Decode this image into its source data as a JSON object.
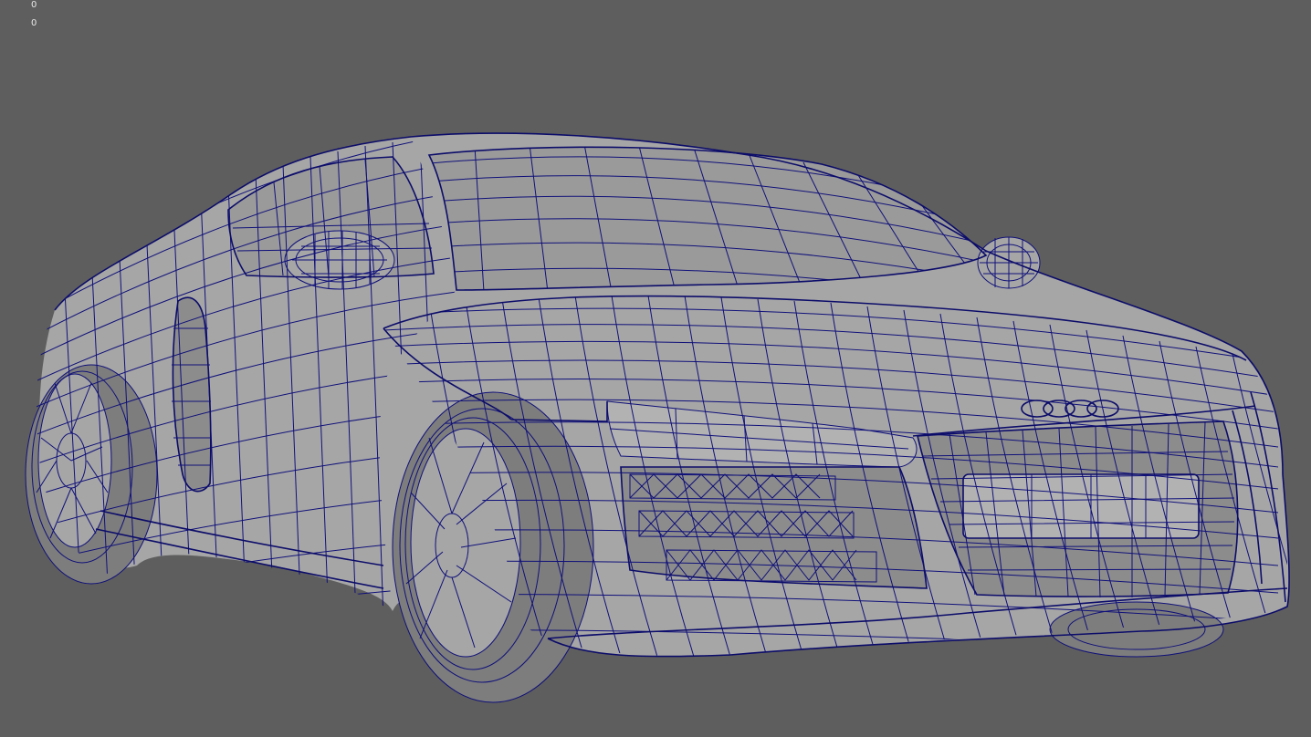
{
  "viewport": {
    "hud_lines": [
      "0",
      "0"
    ],
    "background_color": "#5e5e5e",
    "wire_color": "#10107a",
    "surface_color": "#a6a6a6"
  },
  "model": {
    "name": "",
    "display_mode": "wireframe-on-shaded"
  }
}
